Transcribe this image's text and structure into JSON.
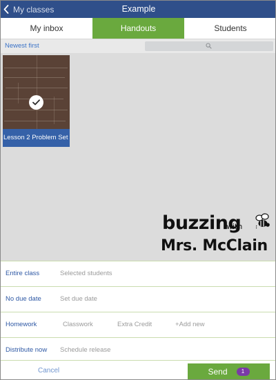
{
  "navbar": {
    "back_label": "My classes",
    "title": "Example"
  },
  "tabs": [
    {
      "label": "My inbox",
      "active": false
    },
    {
      "label": "Handouts",
      "active": true
    },
    {
      "label": "Students",
      "active": false
    }
  ],
  "filter": {
    "sort_label": "Newest first",
    "search_placeholder": ""
  },
  "handouts": [
    {
      "title": "Lesson 2 Problem Set",
      "selected": true,
      "icon": "checkmark-icon"
    }
  ],
  "watermark": {
    "line1": "buzzing",
    "with": "with",
    "line2": "Mrs. McClain"
  },
  "options": {
    "recipients": {
      "selected": "Entire class",
      "alternatives": [
        "Selected students"
      ]
    },
    "due": {
      "selected": "No due date",
      "alternatives": [
        "Set due date"
      ]
    },
    "category": {
      "selected": "Homework",
      "alternatives": [
        "Classwork",
        "Extra Credit",
        "+Add new"
      ]
    },
    "release": {
      "selected": "Distribute now",
      "alternatives": [
        "Schedule release"
      ]
    }
  },
  "footer": {
    "cancel_label": "Cancel",
    "send_label": "Send",
    "send_count": "1"
  },
  "colors": {
    "navbar": "#2f4f8a",
    "accent_green": "#6aa93e",
    "card_label": "#3561a8",
    "badge": "#7a3aa6",
    "link_blue": "#3b73c7"
  }
}
